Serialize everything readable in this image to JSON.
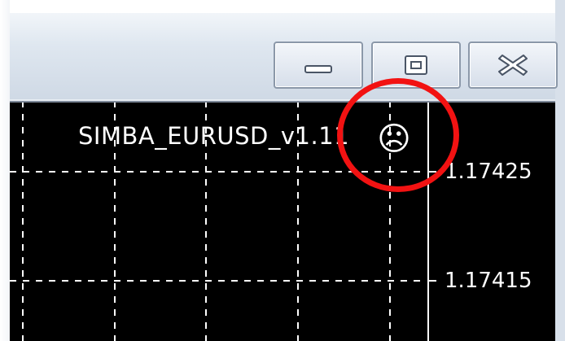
{
  "window": {
    "buttons": {
      "minimize_icon": "minimize-icon",
      "maximize_icon": "restore-icon",
      "close_icon": "close-icon"
    }
  },
  "chart": {
    "indicator_label": "SIMBA_EURUSD_v1.11",
    "status_icon": "☹",
    "price_labels": [
      "1.17425",
      "1.17415"
    ],
    "background_color": "#000000",
    "grid_color": "#ffffff"
  },
  "annotation": {
    "shape": "circle",
    "color": "#f21212"
  }
}
